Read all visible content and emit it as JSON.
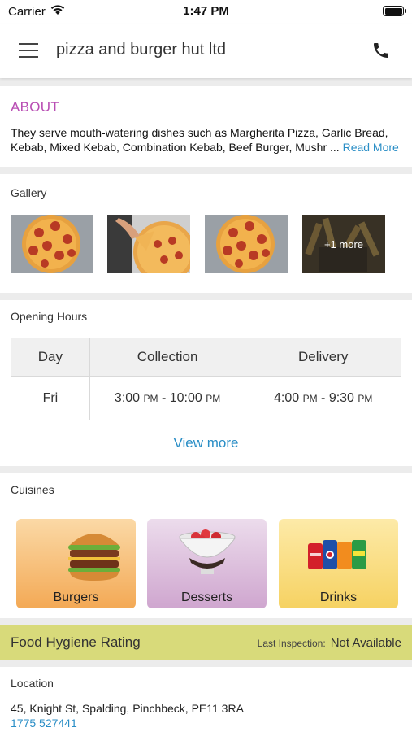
{
  "status_bar": {
    "carrier": "Carrier",
    "time": "1:47 PM"
  },
  "header": {
    "title": "pizza and burger hut ltd",
    "menu_icon": "hamburger-menu-icon",
    "phone_icon": "phone-icon"
  },
  "about": {
    "heading": "ABOUT",
    "text": "They serve mouth-watering dishes such as Margherita Pizza, Garlic Bread, Kebab, Mixed Kebab, Combination Kebab, Beef Burger, Mushr ...",
    "read_more": "Read More"
  },
  "gallery": {
    "label": "Gallery",
    "more_label": "+1 more"
  },
  "opening_hours": {
    "label": "Opening Hours",
    "columns": [
      "Day",
      "Collection",
      "Delivery"
    ],
    "row": {
      "day": "Fri",
      "collection_start": "3:00",
      "collection_end": "10:00",
      "delivery_start": "4:00",
      "delivery_end": "9:30",
      "pm": "PM",
      "dash": "-"
    },
    "view_more": "View more"
  },
  "cuisines": {
    "label": "Cuisines",
    "items": [
      {
        "label": "Burgers"
      },
      {
        "label": "Desserts"
      },
      {
        "label": "Drinks"
      }
    ]
  },
  "hygiene": {
    "title": "Food Hygiene Rating",
    "inspection_label": "Last Inspection:",
    "inspection_value": "Not Available"
  },
  "location": {
    "label": "Location",
    "address": "45, Knight St, Spalding, Pinchbeck, PE11 3RA",
    "phone": "1775 527441"
  },
  "colors": {
    "accent_link": "#2a8ec6",
    "about_heading": "#b84db3",
    "hygiene_bar": "#d8da7a"
  }
}
